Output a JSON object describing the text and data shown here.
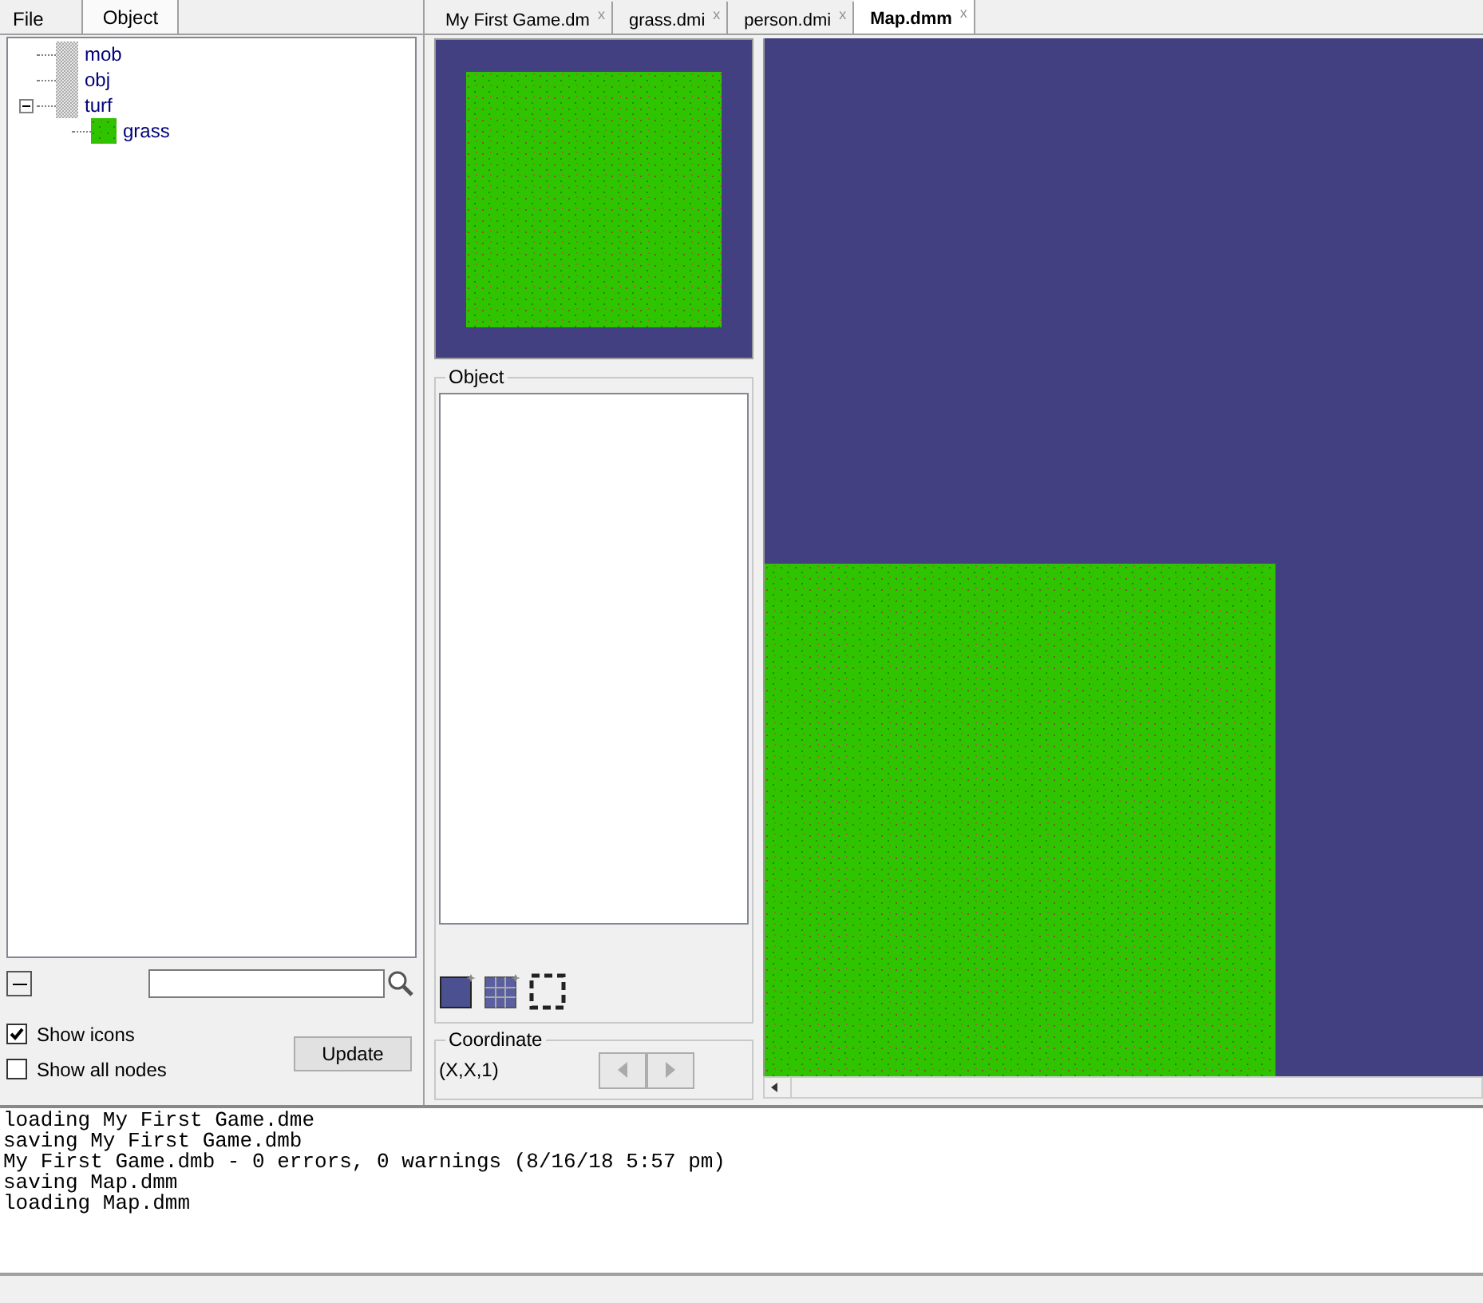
{
  "left_tabs": [
    {
      "label": "File",
      "selected": false
    },
    {
      "label": "Object",
      "selected": true
    }
  ],
  "tree": [
    {
      "label": "mob",
      "kind": "blank"
    },
    {
      "label": "obj",
      "kind": "blank"
    },
    {
      "label": "turf",
      "kind": "blank",
      "expanded": true,
      "children": [
        {
          "label": "grass",
          "kind": "grass"
        }
      ]
    }
  ],
  "options": [
    {
      "label": "Show icons",
      "checked": true
    },
    {
      "label": "Show all nodes",
      "checked": false
    }
  ],
  "update_button": "Update",
  "file_tabs": [
    {
      "label": "My First Game.dm",
      "selected": false,
      "close": "x"
    },
    {
      "label": "grass.dmi",
      "selected": false,
      "close": "x"
    },
    {
      "label": "person.dmi",
      "selected": false,
      "close": "x"
    },
    {
      "label": "Map.dmm",
      "selected": true,
      "close": "x"
    }
  ],
  "object_group": {
    "title": "Object"
  },
  "coordinate_group": {
    "title": "Coordinate",
    "value": "(X,X,1)"
  },
  "console": {
    "lines": [
      "loading My First Game.dme",
      "saving My First Game.dmb",
      "My First Game.dmb - 0 errors, 0 warnings (8/16/18 5:57 pm)",
      "saving Map.dmm",
      "loading Map.dmm"
    ]
  }
}
